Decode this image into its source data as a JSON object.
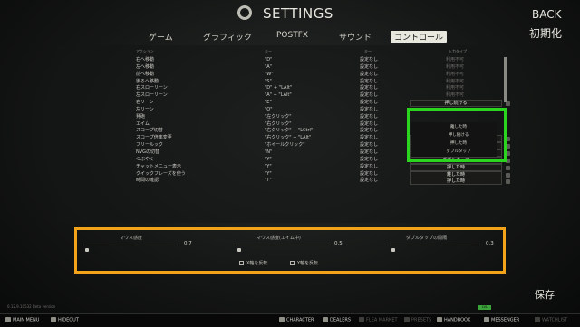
{
  "window": {
    "title": "SETTINGS",
    "back_label": "BACK",
    "reset_label": "初期化",
    "save_label": "保存"
  },
  "tabs": [
    {
      "label": "ゲーム"
    },
    {
      "label": "グラフィック"
    },
    {
      "label": "POSTFX"
    },
    {
      "label": "サウンド"
    },
    {
      "label": "コントロール",
      "active": true
    }
  ],
  "table": {
    "headers": [
      "アクション",
      "キー",
      "キー",
      "入力タイプ"
    ],
    "rows": [
      {
        "action": "右へ移動",
        "key1": "\"D\"",
        "key2": "設定なし",
        "input": "利用不可"
      },
      {
        "action": "左へ移動",
        "key1": "\"A\"",
        "key2": "設定なし",
        "input": "利用不可"
      },
      {
        "action": "前へ移動",
        "key1": "\"W\"",
        "key2": "設定なし",
        "input": "利用不可"
      },
      {
        "action": "後ろへ移動",
        "key1": "\"S\"",
        "key2": "設定なし",
        "input": "利用不可"
      },
      {
        "action": "右スローリーン",
        "key1": "\"D\" + \"LAlt\"",
        "key2": "設定なし",
        "input": "利用不可"
      },
      {
        "action": "左スローリーン",
        "key1": "\"A\" + \"LAlt\"",
        "key2": "設定なし",
        "input": "利用不可"
      },
      {
        "action": "右リーン",
        "key1": "\"E\"",
        "key2": "設定なし",
        "input": "押し続ける",
        "active": true
      },
      {
        "action": "左リーン",
        "key1": "\"Q\"",
        "key2": "設定なし",
        "input": ""
      },
      {
        "action": "発砲",
        "key1": "\"左クリック\"",
        "key2": "設定なし",
        "input": ""
      },
      {
        "action": "エイム",
        "key1": "\"右クリック\"",
        "key2": "設定なし",
        "input": ""
      },
      {
        "action": "スコープ切替",
        "key1": "\"右クリック\" + \"LCtrl\"",
        "key2": "設定なし",
        "input": ""
      },
      {
        "action": "スコープ倍率変更",
        "key1": "\"右クリック\" + \"LAlt\"",
        "key2": "設定なし",
        "input": "押した時",
        "active": true
      },
      {
        "action": "フリールック",
        "key1": "\"ホイールクリック\"",
        "key2": "設定なし",
        "input": "押し続ける",
        "active": true
      },
      {
        "action": "NVGの切替",
        "key1": "\"N\"",
        "key2": "設定なし",
        "input": "押した時",
        "active": true
      },
      {
        "action": "つぶやく",
        "key1": "\"Y\"",
        "key2": "設定なし",
        "input": "ダブルタップ",
        "active": true
      },
      {
        "action": "チャットメニュー表示",
        "key1": "\"Y\"",
        "key2": "設定なし",
        "input": "押した時",
        "active": true
      },
      {
        "action": "クイックフレーズを使う",
        "key1": "\"Y\"",
        "key2": "設定なし",
        "input": "離した時",
        "active": true
      },
      {
        "action": "時間の確認",
        "key1": "\"T\"",
        "key2": "設定なし",
        "input": "押した時",
        "active": true
      }
    ]
  },
  "input_type_dropdown": {
    "options": [
      "離した時",
      "押し続ける",
      "押した時",
      "ダブルタップ"
    ]
  },
  "sliders": [
    {
      "label": "マウス感度",
      "value": "0.7",
      "fraction": 0.05
    },
    {
      "label": "マウス感度(エイム中)",
      "value": "0.5",
      "fraction": 0.05
    },
    {
      "label": "ダブルタップの間隔",
      "value": "0.3",
      "fraction": 0.05
    }
  ],
  "checkboxes": [
    {
      "label": "X軸を反転",
      "checked": false
    },
    {
      "label": "Y軸を反転",
      "checked": false
    }
  ],
  "version": "0.12.9.10532 Beta version",
  "badge": "LVL",
  "bottom_bar": [
    {
      "label": "MAIN MENU",
      "icon": "menu-icon",
      "enabled": true
    },
    {
      "label": "HIDEOUT",
      "icon": "hideout-icon",
      "enabled": true
    },
    {
      "label": "CHARACTER",
      "icon": "character-icon",
      "enabled": true
    },
    {
      "label": "DEALERS",
      "icon": "dealers-icon",
      "enabled": true
    },
    {
      "label": "FLEA MARKET",
      "icon": "flea-market-icon",
      "enabled": false
    },
    {
      "label": "PRESETS",
      "icon": "presets-icon",
      "enabled": false
    },
    {
      "label": "HANDBOOK",
      "icon": "handbook-icon",
      "enabled": true
    },
    {
      "label": "MESSENGER",
      "icon": "messenger-icon",
      "enabled": true
    },
    {
      "label": "WATCHLIST",
      "icon": "watchlist-icon",
      "enabled": false
    }
  ]
}
